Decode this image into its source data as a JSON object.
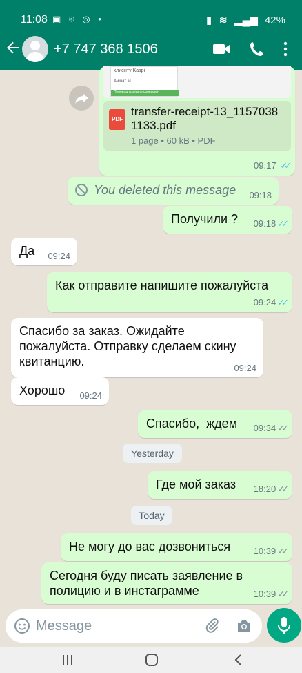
{
  "status_bar": {
    "time": "11:08",
    "notif_icons": "▣ ⌾ ◎ •",
    "battery": "42%"
  },
  "header": {
    "contact": "+7 747 368 1506"
  },
  "file_message": {
    "preview_line1": "клиенту Kaspi",
    "preview_line2": "Айшат М.",
    "preview_line3": "Перевод успешно совершен",
    "pdf_badge": "PDF",
    "file_name": "transfer-receipt-13_11570381133.pdf",
    "file_info": "1 page • 60 kB • PDF",
    "time": "09:17"
  },
  "messages": [
    {
      "text": "You deleted this message",
      "time": "09:18",
      "direction": "out",
      "deleted": true
    },
    {
      "text": "Получили ?",
      "time": "09:18",
      "direction": "out",
      "status": "read"
    },
    {
      "text": "Да",
      "time": "09:24",
      "direction": "in"
    },
    {
      "text": "Как отправите напишите пожалуйста",
      "time": "09:24",
      "direction": "out",
      "status": "read"
    },
    {
      "text": "Спасибо за заказ. Ожидайте пожалуйста. Отправку сделаем скину квитанцию.",
      "time": "09:24",
      "direction": "in"
    },
    {
      "text": "Хорошо",
      "time": "09:24",
      "direction": "in"
    },
    {
      "text": "Спасибо,  ждем",
      "time": "09:34",
      "direction": "out",
      "status": "delivered"
    },
    {
      "text": "Где мой заказ",
      "time": "18:20",
      "direction": "out",
      "status": "delivered"
    },
    {
      "text": "Не могу до вас дозвониться",
      "time": "10:39",
      "direction": "out",
      "status": "delivered"
    },
    {
      "text": "Сегодня буду писать заявление в полицию и в инстаграмме",
      "time": "10:39",
      "direction": "out",
      "status": "delivered"
    }
  ],
  "day_labels": {
    "yesterday": "Yesterday",
    "today": "Today"
  },
  "input": {
    "placeholder": "Message"
  },
  "icons": [
    "back-arrow-icon",
    "avatar",
    "video-call-icon",
    "phone-icon",
    "more-vert-icon",
    "forward-icon",
    "pdf-icon",
    "blocked-icon",
    "emoji-icon",
    "attach-icon",
    "camera-icon",
    "mic-icon",
    "recents-icon",
    "home-icon",
    "nav-back-icon"
  ],
  "colors": {
    "header": "#008069",
    "outgoing_bubble": "#d9fdd3",
    "incoming_bubble": "#ffffff",
    "read_tick": "#53bdeb",
    "mic_button": "#00a884",
    "chat_background": "#e9e2d8"
  }
}
